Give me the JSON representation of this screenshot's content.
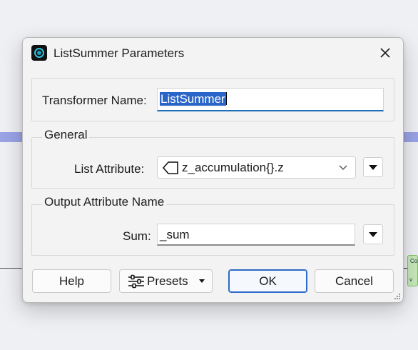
{
  "canvas": {
    "node_label": "Co",
    "node_chevron": "v"
  },
  "dialog": {
    "title": "ListSummer Parameters",
    "icons": {
      "app": "fme-workbench-icon",
      "close": "close-icon"
    },
    "transformer_name": {
      "label": "Transformer Name:",
      "value": "ListSummer"
    },
    "general": {
      "legend": "General",
      "list_attribute_label": "List Attribute:",
      "list_attribute_value": "z_accumulation{}.z",
      "list_attribute_icon": "list-attribute-icon"
    },
    "output": {
      "legend": "Output Attribute Name",
      "sum_label": "Sum:",
      "sum_value": "_sum"
    },
    "buttons": {
      "help": "Help",
      "presets": "Presets",
      "ok": "OK",
      "cancel": "Cancel"
    }
  },
  "colors": {
    "selection": "#2a66c8",
    "focus_underline": "#1f6fb6",
    "canvas_band": "#9aa3e6",
    "node_fill": "#c7e9b9"
  }
}
